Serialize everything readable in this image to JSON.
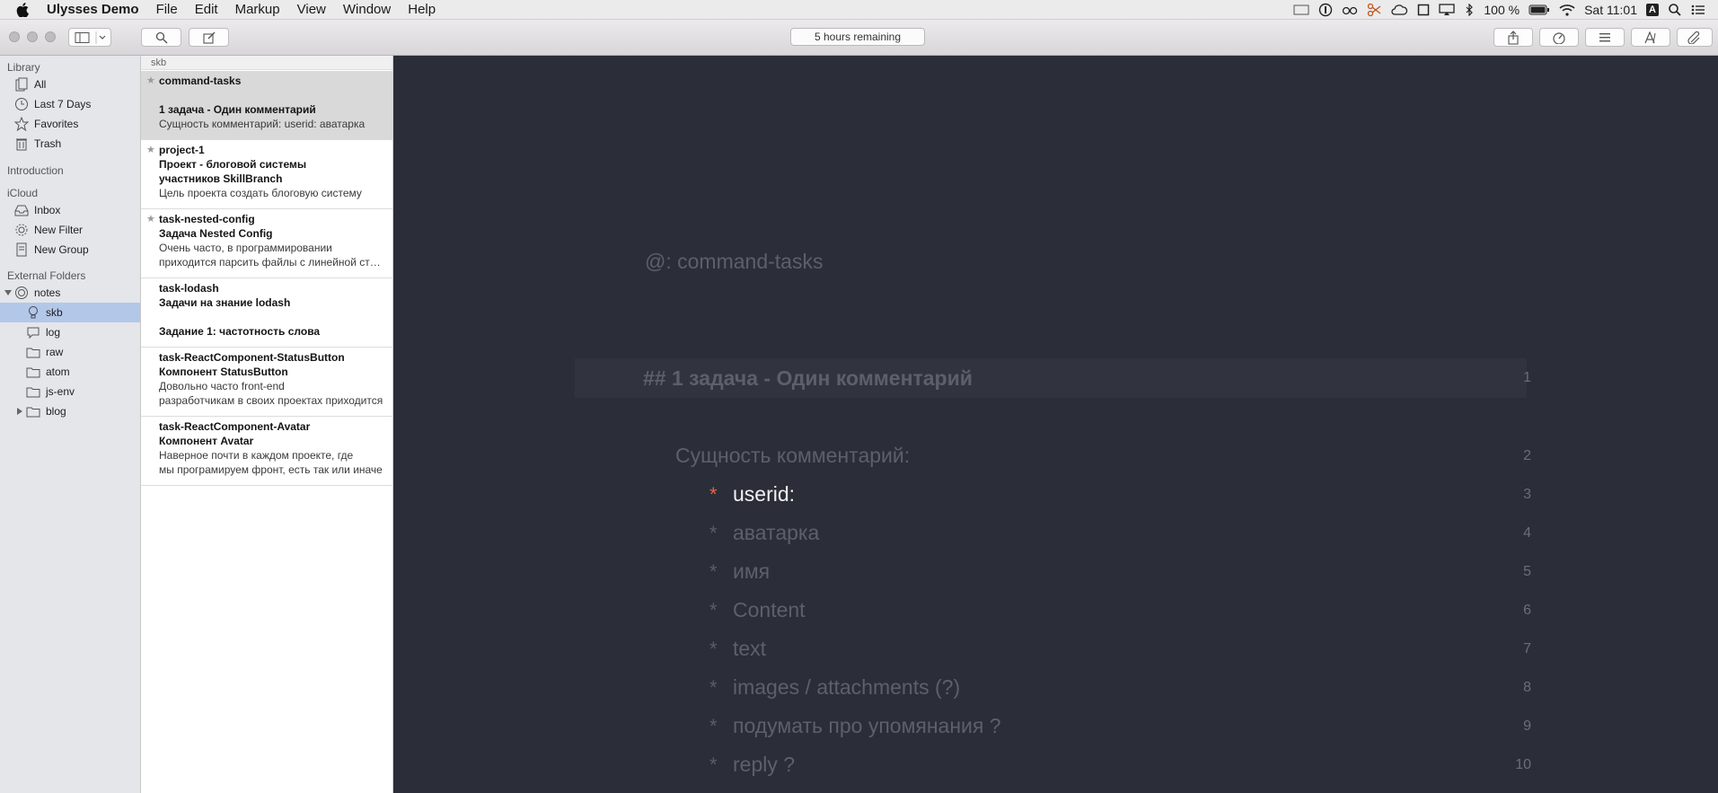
{
  "menubar": {
    "app_name": "Ulysses Demo",
    "items": [
      "File",
      "Edit",
      "Markup",
      "View",
      "Window",
      "Help"
    ],
    "battery": "100 %",
    "clock": "Sat 11:01",
    "input_source": "A"
  },
  "toolbar": {
    "timer": "5 hours remaining"
  },
  "sidebar": {
    "library_title": "Library",
    "library": [
      {
        "label": "All",
        "icon": "all-sheets-icon"
      },
      {
        "label": "Last 7 Days",
        "icon": "clock-icon"
      },
      {
        "label": "Favorites",
        "icon": "star-icon"
      },
      {
        "label": "Trash",
        "icon": "trash-icon"
      }
    ],
    "introduction_title": "Introduction",
    "icloud_title": "iCloud",
    "icloud": [
      {
        "label": "Inbox",
        "icon": "inbox-icon"
      },
      {
        "label": "New Filter",
        "icon": "gear-icon"
      },
      {
        "label": "New Group",
        "icon": "sheet-icon"
      }
    ],
    "external_title": "External Folders",
    "external": [
      {
        "label": "notes",
        "icon": "globe-icon"
      },
      {
        "label": "skb",
        "icon": "lightbulb-icon"
      },
      {
        "label": "log",
        "icon": "speech-bubble-icon"
      },
      {
        "label": "raw",
        "icon": "folder-icon"
      },
      {
        "label": "atom",
        "icon": "folder-icon"
      },
      {
        "label": "js-env",
        "icon": "folder-icon"
      },
      {
        "label": "blog",
        "icon": "folder-icon"
      }
    ]
  },
  "sheets": {
    "group_title": "skb",
    "items": [
      {
        "lines": [
          "command-tasks",
          "",
          "1 задача - Один комментарий",
          "Сущность комментарий: userid: аватарка"
        ],
        "starred": true
      },
      {
        "lines": [
          "project-1",
          "Проект - блоговой системы",
          "участников SkillBranch",
          "Цель проекта создать блоговую систему"
        ],
        "starred": true
      },
      {
        "lines": [
          "task-nested-config",
          "Задача Nested Config",
          "Очень часто, в программировании",
          "приходится парсить файлы с линейной структурой"
        ],
        "starred": true
      },
      {
        "lines": [
          "task-lodash",
          "Задачи на знание lodash",
          "",
          "Задание 1: частотность слова"
        ],
        "starred": false
      },
      {
        "lines": [
          "task-ReactComponent-StatusButton",
          "Компонент StatusButton",
          "Довольно часто front-end",
          "разработчикам в своих проектах приходится"
        ],
        "starred": false
      },
      {
        "lines": [
          "task-ReactComponent-Avatar",
          "Компонент Avatar",
          "Наверное почти в каждом проекте, где",
          "мы програмируем фронт, есть так или иначе"
        ],
        "starred": false
      }
    ]
  },
  "editor": {
    "tag_line": "@: command-tasks",
    "heading": "## 1 задача - Один комментарий",
    "heading_num": "1",
    "paragraph": "Сущность комментарий:",
    "paragraph_num": "2",
    "list_marker": "*",
    "list": [
      {
        "text": "userid:",
        "num": "3"
      },
      {
        "text": "аватарка",
        "num": "4"
      },
      {
        "text": "имя",
        "num": "5"
      },
      {
        "text": "Content",
        "num": "6"
      },
      {
        "text": "text",
        "num": "7"
      },
      {
        "text": "images / attachments (?)",
        "num": "8"
      },
      {
        "text": "подумать про упомянания ?",
        "num": "9"
      },
      {
        "text": "reply ?",
        "num": "10"
      }
    ]
  }
}
